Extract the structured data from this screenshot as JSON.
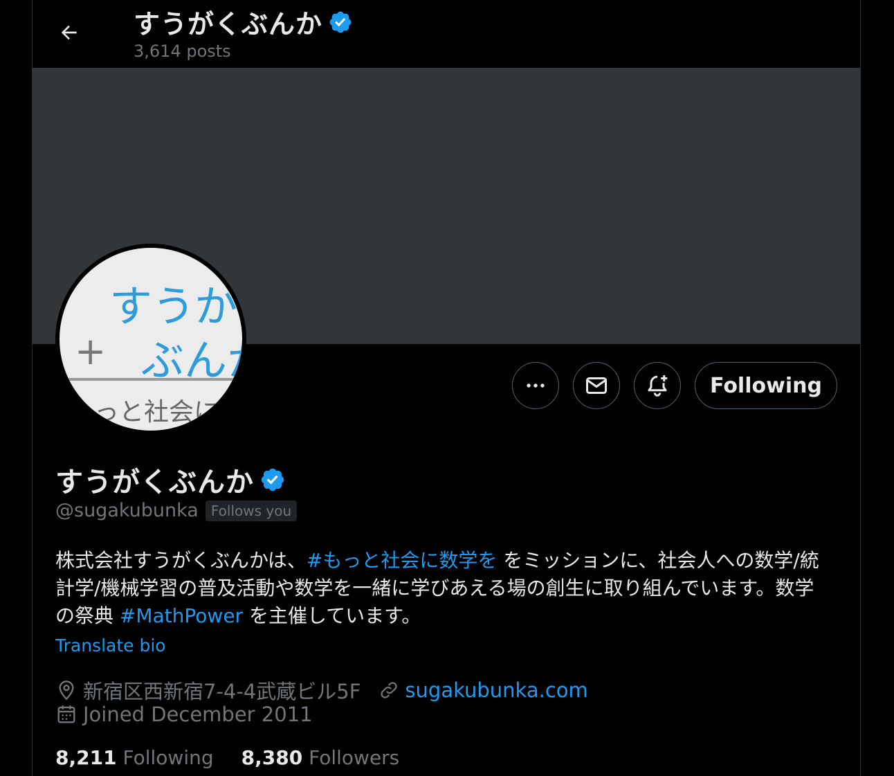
{
  "header": {
    "name": "すうがくぶんか",
    "posts": "3,614 posts"
  },
  "avatar": {
    "line1": "すうがく",
    "line2": "ぶんか",
    "plus": "+",
    "line3": "もっと社会に数学を"
  },
  "actions": {
    "following_label": "Following"
  },
  "profile": {
    "name": "すうがくぶんか",
    "handle": "@sugakubunka",
    "follows_you": "Follows you",
    "bio": {
      "p1": "株式会社すうがくぶんかは、",
      "tag1": "#もっと社会に数学を",
      "p2": " をミッションに、社会人への数学/統計学/機械学習の普及活動や数学を一緒に学びあえる場の創生に取り組んでいます。数学の祭典 ",
      "tag2": "#MathPower",
      "p3": " を主催しています。"
    },
    "translate": "Translate bio",
    "location": "新宿区西新宿7-4-4武蔵ビル5F",
    "website": "sugakubunka.com",
    "joined": "Joined December 2011",
    "following_count": "8,211",
    "following_label": "Following",
    "followers_count": "8,380",
    "followers_label": "Followers"
  },
  "colors": {
    "accent": "#1d9bf0",
    "verified": "#1d9bf0",
    "muted": "#71767b",
    "banner": "#333639"
  },
  "icons": [
    "back-arrow-icon",
    "verified-badge-icon",
    "more-icon",
    "mail-icon",
    "bell-plus-icon",
    "location-pin-icon",
    "link-icon",
    "calendar-icon"
  ]
}
